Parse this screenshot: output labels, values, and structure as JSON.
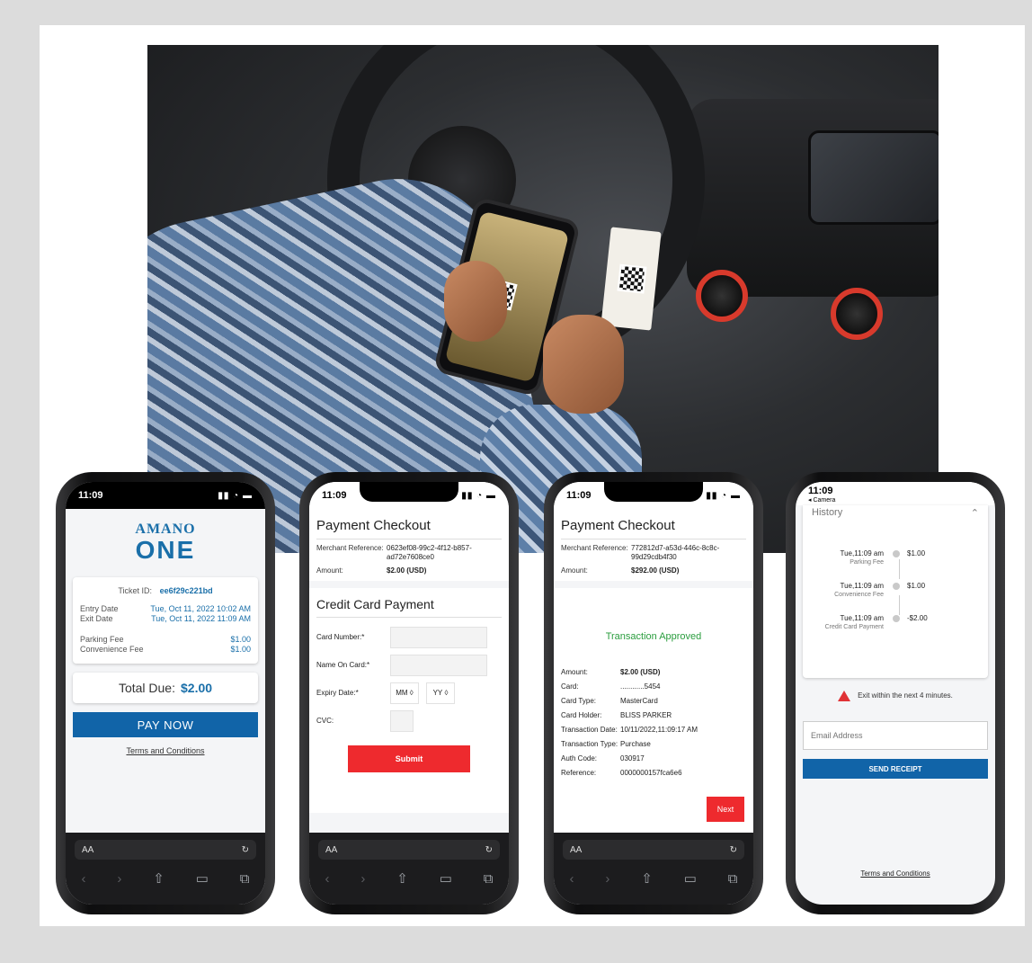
{
  "phone1": {
    "time": "11:09",
    "brand_top": "AMANO",
    "brand_bottom": "ONE",
    "ticket_label": "Ticket ID:",
    "ticket_id": "ee6f29c221bd",
    "entry_label": "Entry Date",
    "entry_value": "Tue, Oct 11, 2022 10:02 AM",
    "exit_label": "Exit Date",
    "exit_value": "Tue, Oct 11, 2022 11:09 AM",
    "parking_label": "Parking Fee",
    "parking_value": "$1.00",
    "convenience_label": "Convenience Fee",
    "convenience_value": "$1.00",
    "total_label": "Total Due:",
    "total_value": "$2.00",
    "pay_label": "PAY NOW",
    "terms": "Terms and Conditions",
    "url_text": "AA"
  },
  "phone2": {
    "time": "11:09",
    "title": "Payment Checkout",
    "merchant_label": "Merchant Reference:",
    "merchant_value": "0623ef08-99c2-4f12-b857-ad72e7608ce0",
    "amount_label": "Amount:",
    "amount_value": "$2.00 (USD)",
    "cc_title": "Credit Card Payment",
    "card_number_label": "Card Number:*",
    "name_label": "Name On Card:*",
    "expiry_label": "Expiry Date:*",
    "month_placeholder": "MM",
    "year_placeholder": "YY",
    "cvc_label": "CVC:",
    "submit_label": "Submit",
    "url_text": "AA"
  },
  "phone3": {
    "time": "11:09",
    "title": "Payment Checkout",
    "merchant_label": "Merchant Reference:",
    "merchant_value": "772812d7-a53d-446c-8c8c-99d29cdb4f30",
    "amount_label": "Amount:",
    "amount_value": "$292.00 (USD)",
    "approved": "Transaction Approved",
    "rows": [
      {
        "k": "Amount:",
        "v": "$2.00 (USD)"
      },
      {
        "k": "Card:",
        "v": "............5454"
      },
      {
        "k": "Card Type:",
        "v": "MasterCard"
      },
      {
        "k": "Card Holder:",
        "v": "BLISS PARKER"
      },
      {
        "k": "Transaction Date:",
        "v": "10/11/2022,11:09:17 AM"
      },
      {
        "k": "Transaction Type:",
        "v": "Purchase"
      },
      {
        "k": "Auth Code:",
        "v": "030917"
      },
      {
        "k": "Reference:",
        "v": "0000000157fca6e6"
      }
    ],
    "next_label": "Next",
    "url_text": "AA"
  },
  "phone4": {
    "time": "11:09",
    "back_label": "◂ Camera",
    "history_title": "History",
    "items": [
      {
        "time": "Tue,11:09 am",
        "desc": "Parking Fee",
        "amount": "$1.00"
      },
      {
        "time": "Tue,11:09 am",
        "desc": "Convenience Fee",
        "amount": "$1.00"
      },
      {
        "time": "Tue,11:09 am",
        "desc": "Credit Card Payment",
        "amount": "-$2.00"
      }
    ],
    "warning": "Exit within the next 4 minutes.",
    "email_placeholder": "Email Address",
    "send_label": "SEND RECEIPT",
    "terms": "Terms and Conditions"
  },
  "colors": {
    "brand_blue": "#1164a8",
    "accent_red": "#ee2a2e",
    "approved_green": "#2a9d3e"
  }
}
